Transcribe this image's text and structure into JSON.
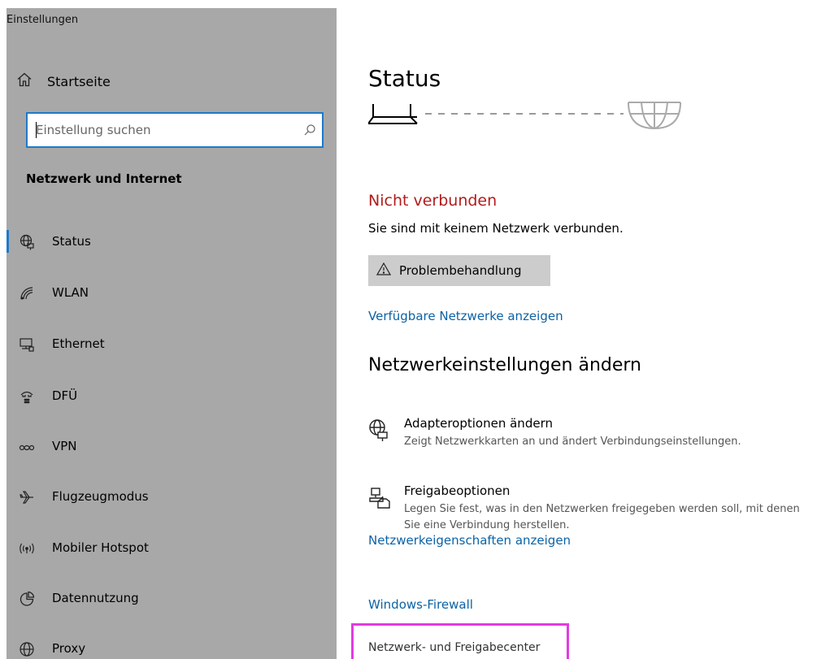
{
  "window": {
    "title": "Einstellungen"
  },
  "sidebar": {
    "home_label": "Startseite",
    "search": {
      "placeholder": "Einstellung suchen"
    },
    "section_heading": "Netzwerk und Internet",
    "items": [
      {
        "label": "Status",
        "icon": "globe-network-icon",
        "selected": true
      },
      {
        "label": "WLAN",
        "icon": "wifi-icon",
        "selected": false
      },
      {
        "label": "Ethernet",
        "icon": "ethernet-icon",
        "selected": false
      },
      {
        "label": "DFÜ",
        "icon": "dialup-icon",
        "selected": false
      },
      {
        "label": "VPN",
        "icon": "vpn-icon",
        "selected": false
      },
      {
        "label": "Flugzeugmodus",
        "icon": "airplane-icon",
        "selected": false
      },
      {
        "label": "Mobiler Hotspot",
        "icon": "hotspot-icon",
        "selected": false
      },
      {
        "label": "Datennutzung",
        "icon": "data-usage-icon",
        "selected": false
      },
      {
        "label": "Proxy",
        "icon": "globe-icon",
        "selected": false
      }
    ]
  },
  "main": {
    "title": "Status",
    "status_text": "Nicht verbunden",
    "status_desc": "Sie sind mit keinem Netzwerk verbunden.",
    "troubleshoot_label": "Problembehandlung",
    "available_networks_link": "Verfügbare Netzwerke anzeigen",
    "change_settings_heading": "Netzwerkeinstellungen ändern",
    "options": [
      {
        "title": "Adapteroptionen ändern",
        "desc": "Zeigt Netzwerkkarten an und ändert Verbindungseinstellungen."
      },
      {
        "title": "Freigabeoptionen",
        "desc": "Legen Sie fest, was in den Netzwerken freigegeben werden soll, mit denen Sie eine Verbindung herstellen."
      }
    ],
    "properties_link": "Netzwerkeigenschaften anzeigen",
    "firewall_link": "Windows-Firewall",
    "network_center_link": "Netzwerk- und Freigabecenter"
  },
  "colors": {
    "sidebar_bg": "#a8a8a8",
    "accent": "#1f79c9",
    "error": "#b21c1c",
    "link": "#0b62a6",
    "highlight": "#e23be0"
  }
}
